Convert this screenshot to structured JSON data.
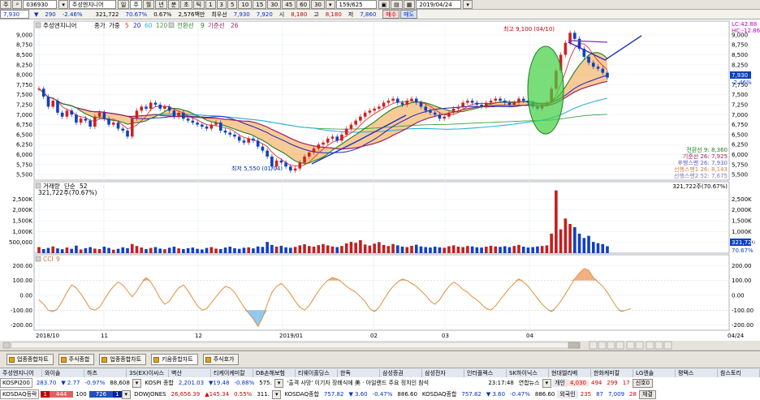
{
  "toolbar": {
    "menu_label": "주",
    "stock_code": "036930",
    "stock_name": "주성엔지니어",
    "period_buttons": [
      "일",
      "주",
      "월",
      "년",
      "분",
      "초",
      "틱"
    ],
    "interval_buttons": [
      "1",
      "3",
      "5",
      "10",
      "15",
      "30",
      "45",
      "60",
      "30"
    ],
    "count_value": "159",
    "count_total": "625",
    "date_value": "2019/04/24"
  },
  "quote": {
    "price": "7,930",
    "change": "290",
    "change_pct": "-2.46%",
    "volume": "321,722",
    "volume_ratio": "70.67%",
    "turnover_pct": "0.67%",
    "amount": "2,576백만",
    "prev_label": "최우선",
    "ask": "7,930",
    "bid": "7,920",
    "open_label": "시",
    "open": "8,180",
    "high_label": "고",
    "high": "8,180",
    "low_label": "저",
    "low": "7,860",
    "buy_label": "매수",
    "sell_label": "매도"
  },
  "chart_data": [
    {
      "type": "line",
      "name": "price-panel",
      "legend": [
        "주성엔지니어",
        "종가",
        "가중",
        "5",
        "20",
        "60",
        "120",
        "전환선",
        "9",
        "기준선",
        "26"
      ],
      "colors": {
        "ma5": "#e03030",
        "ma20": "#2020d0",
        "ma60": "#30b0e0",
        "ma120": "#40a040",
        "conversion": "#208020",
        "base": "#a02060",
        "candle_up": "#d02020",
        "candle_down": "#1040c0"
      },
      "y_ticks": [
        "9,000",
        "8,750",
        "8,500",
        "8,250",
        "8,000",
        "7,750",
        "7,500",
        "7,250",
        "7,000",
        "6,750",
        "6,500",
        "6,250",
        "6,000",
        "5,750",
        "5,500"
      ],
      "ylim": [
        5400,
        9100
      ],
      "x_ticks": [
        "2018/10",
        "11",
        "12",
        "2019/01",
        "02",
        "03",
        "04",
        "04/24"
      ],
      "close": [
        7650,
        7450,
        7200,
        7350,
        7050,
        6950,
        7100,
        7000,
        6800,
        6900,
        6850,
        6700,
        6950,
        7050,
        6900,
        6750,
        6800,
        6650,
        6600,
        6450,
        6900,
        7100,
        7200,
        7150,
        7300,
        7250,
        7150,
        7200,
        7100,
        6950,
        7050,
        6900,
        6850,
        6800,
        6750,
        6700,
        6650,
        6750,
        6800,
        6600,
        6550,
        6500,
        6450,
        6350,
        6300,
        6400,
        6350,
        6200,
        6100,
        5950,
        5700,
        5850,
        5800,
        5700,
        5600,
        5650,
        5800,
        5950,
        6050,
        6150,
        6250,
        6300,
        6400,
        6450,
        6350,
        6500,
        6650,
        6750,
        6850,
        6950,
        7050,
        7100,
        7150,
        7200,
        7300,
        7350,
        7400,
        7300,
        7250,
        7350,
        7400,
        7300,
        7200,
        7100,
        7050,
        7000,
        6900,
        6950,
        7050,
        7150,
        7200,
        7300,
        7350,
        7300,
        7250,
        7200,
        7300,
        7350,
        7400,
        7350,
        7300,
        7250,
        7300,
        7400,
        7350,
        7300,
        7200,
        7150,
        7250,
        7300,
        7650,
        8100,
        8500,
        8800,
        9050,
        8900,
        8650,
        8450,
        8300,
        8200,
        8150,
        8050,
        7930
      ],
      "annotations": {
        "high": "최고 9,100 (04/10)",
        "low": "최저 5,550 (01/04)"
      },
      "right_labels": [
        "전환선 9: 8,360",
        "기준선 26: 7,925",
        "후행스팬 26: 7,930",
        "선행스팬1 26: 8,143",
        "선행스팬2 52: 7,675"
      ],
      "top_right_labels": [
        "LC:42.88",
        "HC:-12.86"
      ],
      "current_price_label": "7,930",
      "current_pct_label": "-2.46%"
    },
    {
      "type": "bar",
      "name": "volume-panel",
      "legend": [
        "거래량",
        "단순",
        "52"
      ],
      "subtitle": "321,722주(70.67%)",
      "right_info": "321,722주(70.67%)",
      "y_ticks": [
        "2,500K",
        "2,000K",
        "1,500K",
        "1,000K",
        "500,000"
      ],
      "ylim": [
        0,
        3000000
      ],
      "badge_values": [
        "321,722",
        "70.67%"
      ],
      "values": [
        280000,
        190000,
        240000,
        310000,
        220000,
        180000,
        260000,
        200000,
        350000,
        170000,
        230000,
        280000,
        210000,
        190000,
        300000,
        240000,
        160000,
        200000,
        270000,
        230000,
        420000,
        330000,
        260000,
        190000,
        240000,
        280000,
        210000,
        180000,
        250000,
        300000,
        220000,
        190000,
        230000,
        260000,
        200000,
        170000,
        240000,
        280000,
        210000,
        190000,
        260000,
        300000,
        230000,
        200000,
        250000,
        270000,
        220000,
        310000,
        290000,
        520000,
        380000,
        300000,
        340000,
        270000,
        250000,
        290000,
        360000,
        410000,
        330000,
        300000,
        370000,
        420000,
        360000,
        310000,
        280000,
        330000,
        450000,
        520000,
        480000,
        600000,
        400000,
        350000,
        440000,
        510000,
        380000,
        330000,
        420000,
        360000,
        300000,
        280000,
        340000,
        390000,
        310000,
        280000,
        260000,
        300000,
        270000,
        250000,
        320000,
        360000,
        300000,
        280000,
        330000,
        310000,
        270000,
        260000,
        300000,
        340000,
        310000,
        290000,
        320000,
        280000,
        330000,
        380000,
        300000,
        260000,
        280000,
        310000,
        330000,
        360000,
        900000,
        2900000,
        1100000,
        1600000,
        1350000,
        1200000,
        900000,
        700000,
        800000,
        520000,
        460000,
        420000,
        321722
      ]
    },
    {
      "type": "area",
      "name": "cci-panel",
      "legend": [
        "CCI",
        "9"
      ],
      "y_ticks": [
        "200.00",
        "100.00",
        "0.00",
        "-100.00",
        "-200.00"
      ],
      "ylim": [
        -230,
        230
      ],
      "values": [
        -30,
        -60,
        -100,
        -110,
        -90,
        -40,
        20,
        70,
        50,
        10,
        -40,
        -90,
        -100,
        -80,
        -30,
        20,
        60,
        90,
        70,
        30,
        -10,
        30,
        80,
        120,
        90,
        40,
        -20,
        -60,
        -40,
        10,
        50,
        70,
        30,
        -20,
        -70,
        -100,
        -90,
        -50,
        -10,
        30,
        60,
        50,
        20,
        -30,
        -80,
        -120,
        -160,
        -210,
        -150,
        -60,
        20,
        60,
        80,
        50,
        10,
        -40,
        -80,
        -100,
        -70,
        -20,
        30,
        70,
        100,
        120,
        110,
        90,
        60,
        40,
        20,
        -10,
        -40,
        -90,
        -110,
        -80,
        -30,
        20,
        60,
        90,
        110,
        100,
        80,
        60,
        30,
        0,
        -40,
        -60,
        -30,
        20,
        60,
        90,
        70,
        40,
        20,
        -10,
        -30,
        -60,
        -90,
        -100,
        -70,
        -30,
        10,
        50,
        80,
        110,
        90,
        60,
        20,
        -20,
        -60,
        -90,
        -110,
        -80,
        -40,
        10,
        60,
        110,
        150,
        180,
        170,
        120,
        90,
        60,
        20,
        -30,
        -80,
        -110,
        -100,
        -90
      ]
    }
  ],
  "bottom_tabs": [
    "업종종합차트",
    "주식종합",
    "업종종합차트",
    "키움종합차트",
    "주식호가"
  ],
  "ticker_header": [
    "주성엔지니어",
    "와이솔",
    "하츠",
    "3S(EX)이씨스",
    "벽산",
    "티케이케미칼",
    "DB손해보험",
    "티웨이홀딩스",
    "한독",
    "삼성증권",
    "삼성전자",
    "인터플렉스",
    "SK하이닉스",
    "현대엘리베",
    "한화케미칼",
    "LG엔솔",
    "평택스",
    "참스토리"
  ],
  "ticker_row1": {
    "label": "KOSPI200",
    "value": "283.70",
    "change": "▼ 2.77",
    "pct": "-0.97%",
    "amount": "88,608",
    "label2": "KOSPI 종합",
    "value2": "2,201.03",
    "change2": "▼19.48",
    "pct2": "-0.88%",
    "amount2": "575.",
    "news": "'출격 사망' 이기자 장례식에 美 · 아일랜드 주요 정치인 참석",
    "time": "23:17:48",
    "source": "연합뉴스",
    "side_label": "개인",
    "side_values": [
      "4,030",
      "494",
      "299",
      "17"
    ],
    "right_label": "신호0"
  },
  "ticker_row2": {
    "label": "KOSDAQ등락",
    "values": [
      "1",
      "444",
      "100",
      "726",
      "1"
    ],
    "label2": "DOWJONES",
    "value2": "26,656.39",
    "change2": "▲145.34",
    "pct2": "0.55%",
    "amount2": "311.",
    "label3": "KOSDAQ종합",
    "value3": "757.82",
    "change3": "▼ 3.60",
    "pct3": "-0.47%",
    "amount3": "886.60",
    "label4": "KOSDAQ종합",
    "value4": "757.82",
    "change4": "▼ 3.60",
    "pct4": "-0.47%",
    "amount4": "886.60",
    "side_label": "외국인",
    "side_values": [
      "235",
      "87",
      "7,009",
      "28"
    ],
    "right_label": "체결"
  }
}
